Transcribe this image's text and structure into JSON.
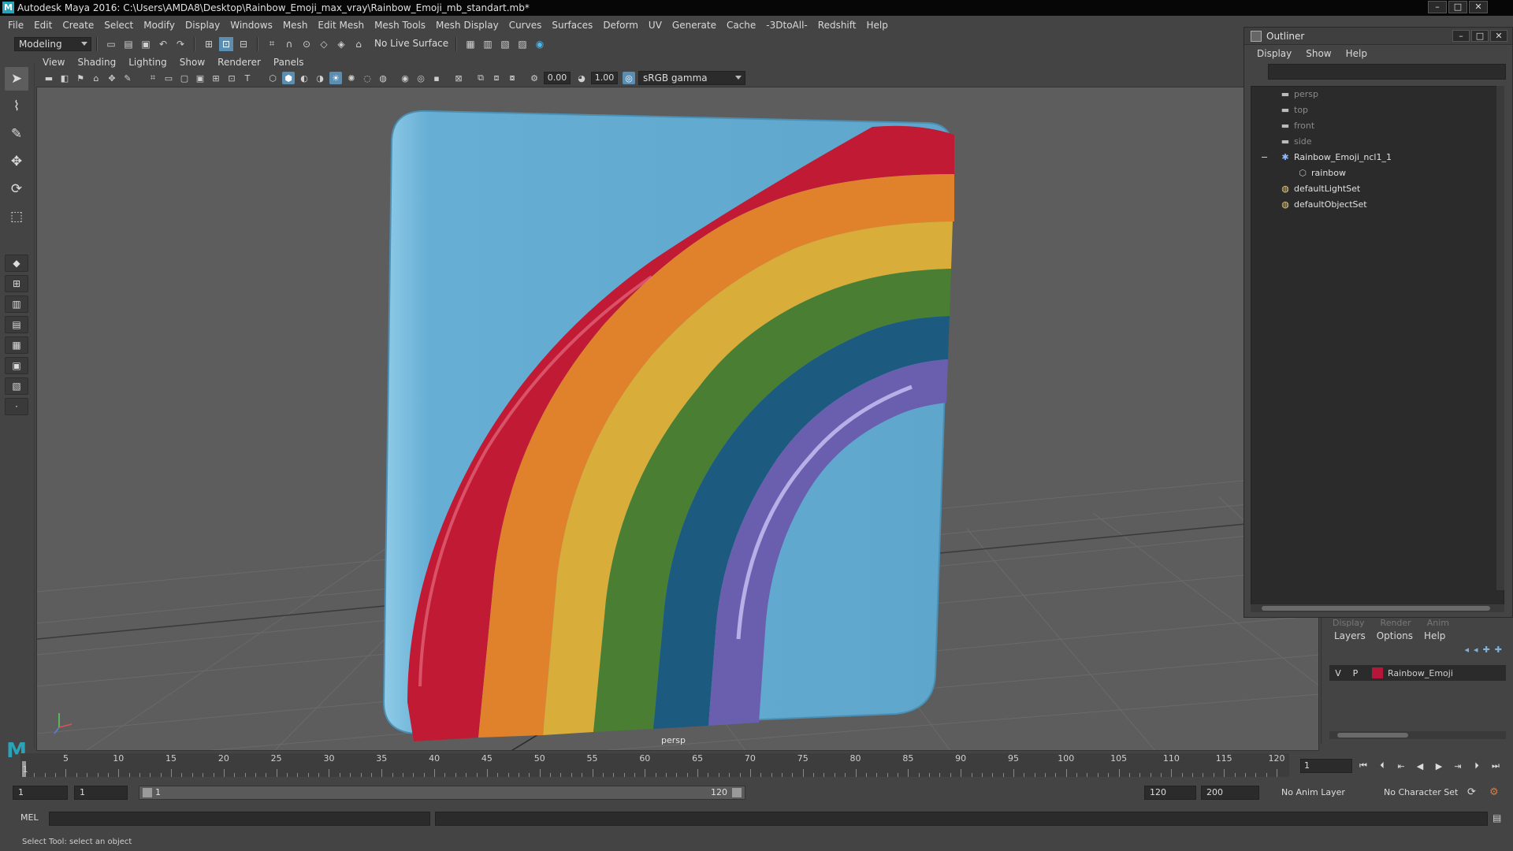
{
  "window": {
    "title": "Autodesk Maya 2016: C:\\Users\\AMDA8\\Desktop\\Rainbow_Emoji_max_vray\\Rainbow_Emoji_mb_standart.mb*"
  },
  "menubar": [
    "File",
    "Edit",
    "Create",
    "Select",
    "Modify",
    "Display",
    "Windows",
    "Mesh",
    "Edit Mesh",
    "Mesh Tools",
    "Mesh Display",
    "Curves",
    "Surfaces",
    "Deform",
    "UV",
    "Generate",
    "Cache",
    "-3DtoAll-",
    "Redshift",
    "Help"
  ],
  "statusline": {
    "mode": "Modeling",
    "live_surface": "No Live Surface"
  },
  "panel": {
    "menu": [
      "View",
      "Shading",
      "Lighting",
      "Show",
      "Renderer",
      "Panels"
    ],
    "exposure": "0.00",
    "gamma": "1.00",
    "color_space": "sRGB gamma",
    "camera_label": "persp"
  },
  "outliner": {
    "title": "Outliner",
    "menu": [
      "Display",
      "Show",
      "Help"
    ],
    "items": [
      {
        "label": "persp",
        "icon": "camera-icon",
        "dim": true,
        "indent": 2
      },
      {
        "label": "top",
        "icon": "camera-icon",
        "dim": true,
        "indent": 2
      },
      {
        "label": "front",
        "icon": "camera-icon",
        "dim": true,
        "indent": 2
      },
      {
        "label": "side",
        "icon": "camera-icon",
        "dim": true,
        "indent": 2
      },
      {
        "label": "Rainbow_Emoji_ncl1_1",
        "icon": "group-icon",
        "dim": false,
        "indent": 2,
        "expand": "−"
      },
      {
        "label": "rainbow",
        "icon": "mesh-icon",
        "dim": false,
        "indent": 3
      },
      {
        "label": "defaultLightSet",
        "icon": "set-icon",
        "dim": false,
        "indent": 2
      },
      {
        "label": "defaultObjectSet",
        "icon": "set-icon",
        "dim": false,
        "indent": 2
      }
    ]
  },
  "layer_editor": {
    "tabs": [
      "Display",
      "Render",
      "Anim"
    ],
    "menu": [
      "Layers",
      "Options",
      "Help"
    ],
    "layer": {
      "v": "V",
      "p": "P",
      "name": "Rainbow_Emoji",
      "color": "#b5163a"
    }
  },
  "timeline": {
    "ticks": [
      "5",
      "10",
      "15",
      "20",
      "25",
      "30",
      "35",
      "40",
      "45",
      "50",
      "55",
      "60",
      "65",
      "70",
      "75",
      "80",
      "85",
      "90",
      "95",
      "100",
      "105",
      "110",
      "115",
      "120"
    ],
    "start_tick": "1",
    "current_frame": "1"
  },
  "range": {
    "start": "1",
    "playback_start": "1",
    "bar_start": "1",
    "bar_end": "120",
    "playback_end": "120",
    "end": "200",
    "anim_layer": "No Anim Layer",
    "char_set": "No Character Set"
  },
  "cmd": {
    "mel_label": "MEL"
  },
  "helpline": "Select Tool: select an object",
  "colors": {
    "card": "#5ea9cf",
    "red": "#c11a35",
    "orange": "#e0822c",
    "yellow": "#d8ad3a",
    "green": "#4a7e32",
    "blue": "#1d5a7f",
    "purple": "#6a5fae"
  }
}
